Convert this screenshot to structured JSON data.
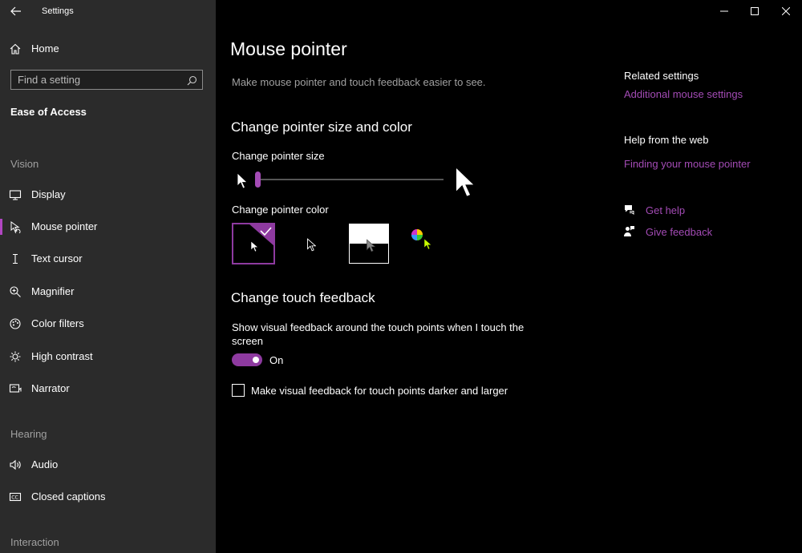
{
  "window": {
    "title": "Settings",
    "back_icon": "back-arrow-icon",
    "minimize_icon": "minimize-icon",
    "maximize_icon": "maximize-icon",
    "close_icon": "close-icon"
  },
  "sidebar": {
    "home_label": "Home",
    "search_placeholder": "Find a setting",
    "category": "Ease of Access",
    "sections": [
      {
        "title": "Vision",
        "items": [
          {
            "label": "Display",
            "icon": "monitor-icon"
          },
          {
            "label": "Mouse pointer",
            "icon": "mouse-pointer-icon",
            "active": true
          },
          {
            "label": "Text cursor",
            "icon": "text-cursor-icon"
          },
          {
            "label": "Magnifier",
            "icon": "magnifier-icon"
          },
          {
            "label": "Color filters",
            "icon": "color-filters-icon"
          },
          {
            "label": "High contrast",
            "icon": "high-contrast-icon"
          },
          {
            "label": "Narrator",
            "icon": "narrator-icon"
          }
        ]
      },
      {
        "title": "Hearing",
        "items": [
          {
            "label": "Audio",
            "icon": "speaker-icon"
          },
          {
            "label": "Closed captions",
            "icon": "closed-captions-icon"
          }
        ]
      },
      {
        "title": "Interaction",
        "items": []
      }
    ]
  },
  "main": {
    "title": "Mouse pointer",
    "description": "Make mouse pointer and touch feedback easier to see.",
    "size_color": {
      "heading": "Change pointer size and color",
      "size_label": "Change pointer size",
      "size_value": 0.0,
      "color_label": "Change pointer color",
      "color_options": [
        {
          "icon": "pointer-white-icon",
          "selected": true
        },
        {
          "icon": "pointer-black-icon",
          "selected": false
        },
        {
          "icon": "pointer-inverted-icon",
          "selected": false
        },
        {
          "icon": "pointer-custom-color-icon",
          "selected": false
        }
      ]
    },
    "touch": {
      "heading": "Change touch feedback",
      "feedback_label": "Show visual feedback around the touch points when I touch the screen",
      "toggle_state": "On",
      "checkbox_label": "Make visual feedback for touch points darker and larger",
      "checkbox_checked": false
    }
  },
  "right_panel": {
    "related_title": "Related settings",
    "related_link": "Additional mouse settings",
    "help_title": "Help from the web",
    "help_link": "Finding your mouse pointer",
    "get_help": "Get help",
    "give_feedback": "Give feedback"
  },
  "colors": {
    "accent": "#a34bb5",
    "toggle": "#8e3aa0",
    "sidebar_bg": "#2b2b2b",
    "main_bg": "#000000"
  }
}
